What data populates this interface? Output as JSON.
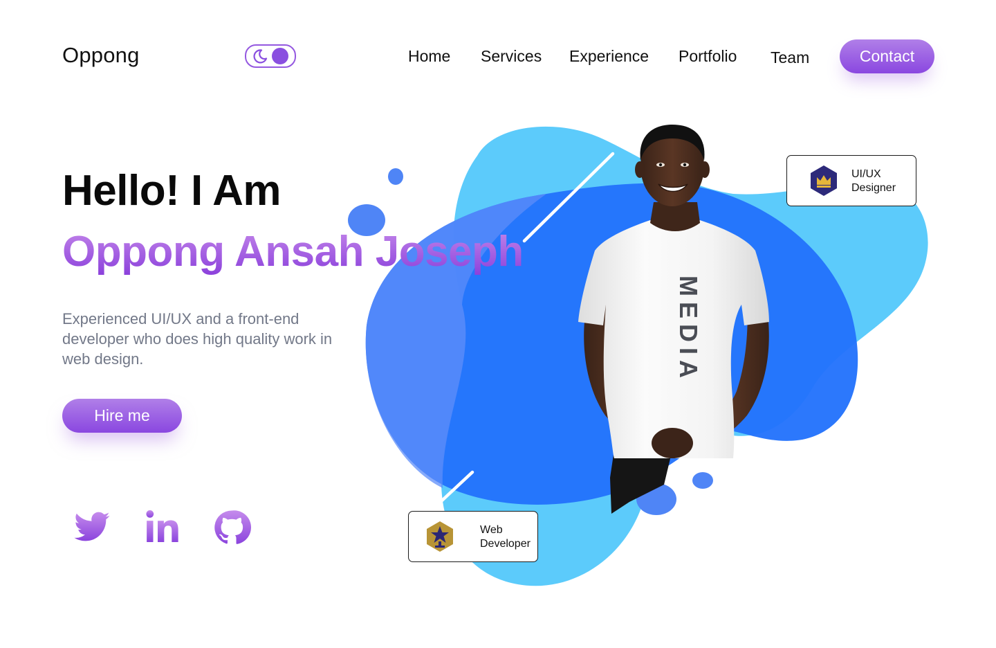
{
  "header": {
    "logo": "Oppong",
    "nav": [
      {
        "label": "Home"
      },
      {
        "label": "Services"
      },
      {
        "label": "Experience"
      },
      {
        "label": "Portfolio"
      },
      {
        "label": "Team"
      }
    ],
    "contact_label": "Contact"
  },
  "theme_toggle": {
    "icon": "moon-icon"
  },
  "hero": {
    "greeting": "Hello! I Am",
    "name": "Oppong Ansah Joseph",
    "bio": "Experienced UI/UX and a front-end developer who does high quality work in web design.",
    "hire_label": "Hire me"
  },
  "badges": {
    "uiux": {
      "line1": "UI/UX",
      "line2": "Designer",
      "icon": "crown-icon"
    },
    "web": {
      "line1": "Web",
      "line2": "Developer",
      "icon": "star-icon"
    }
  },
  "social": [
    {
      "icon": "twitter-icon"
    },
    {
      "icon": "linkedin-icon"
    },
    {
      "icon": "github-icon"
    }
  ],
  "colors": {
    "accent_purple": "#8a47e0",
    "accent_purple_light": "#b07fe8",
    "blob_light_blue": "#5ccbfb",
    "blob_dark_blue": "#2575fc",
    "bubble_blue": "#5a8bf7",
    "text_gray": "#727888"
  }
}
